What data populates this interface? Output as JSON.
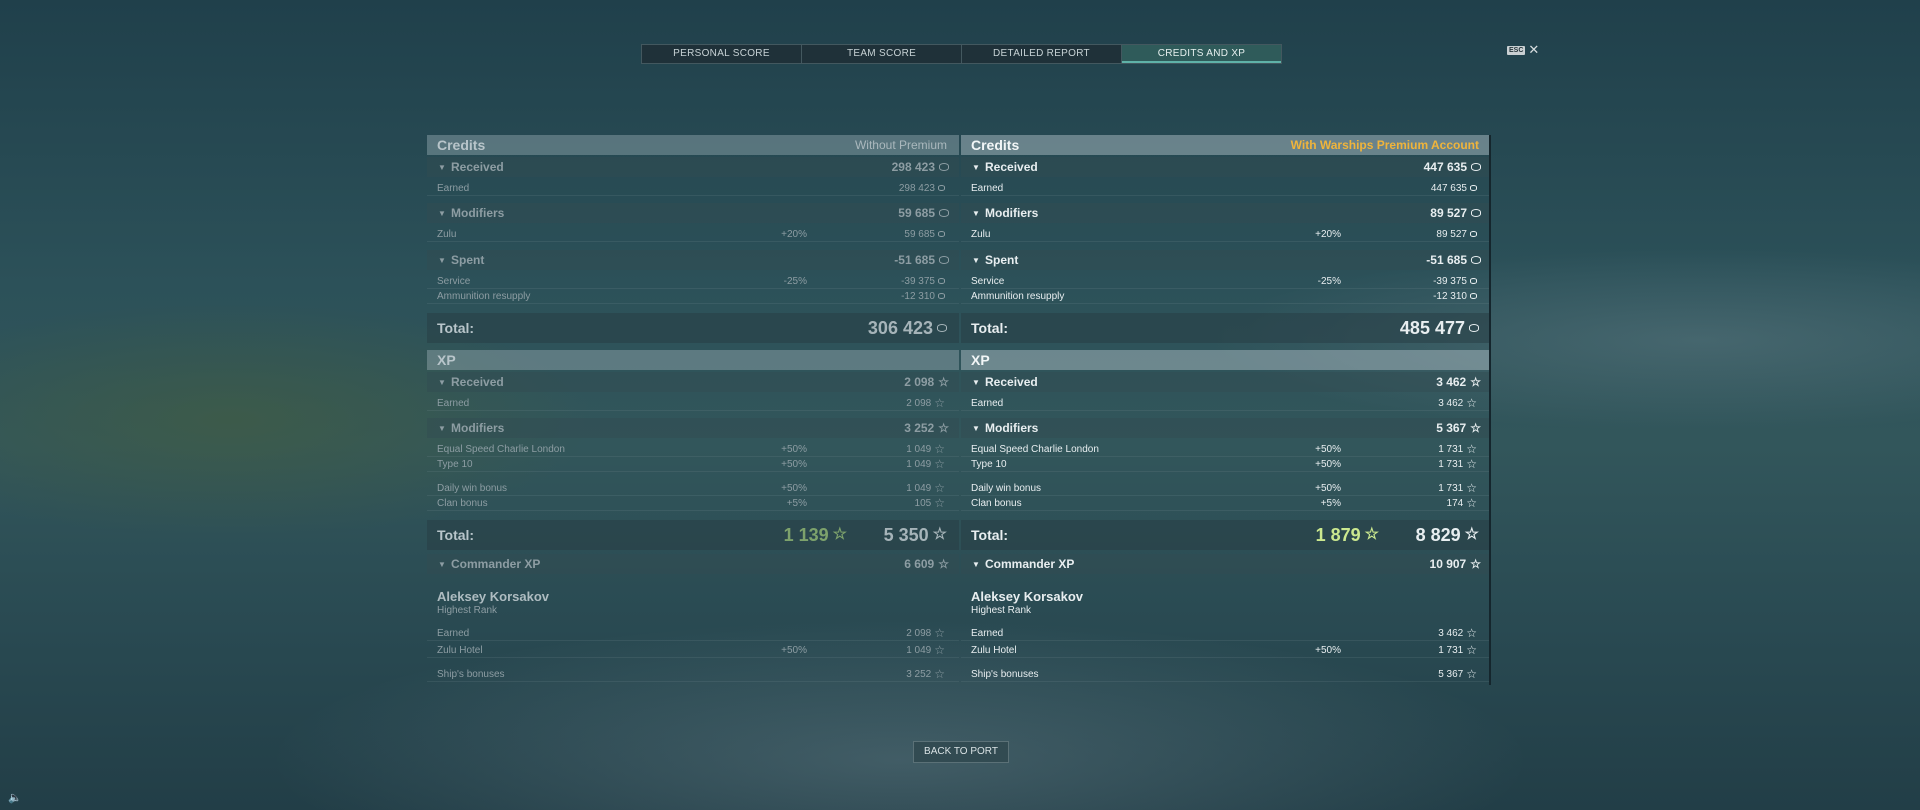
{
  "tabs": [
    "PERSONAL SCORE",
    "TEAM SCORE",
    "DETAILED REPORT",
    "CREDITS AND XP"
  ],
  "close": {
    "key": "ESC",
    "icon": "close-icon"
  },
  "left": {
    "credits_title": "Credits",
    "credits_note": "Without Premium",
    "received": {
      "label": "Received",
      "value": "298 423"
    },
    "earned": {
      "label": "Earned",
      "value": "298 423"
    },
    "modifiers": {
      "label": "Modifiers",
      "value": "59 685"
    },
    "zulu": {
      "label": "Zulu",
      "pct": "+20%",
      "value": "59 685"
    },
    "spent": {
      "label": "Spent",
      "value": "-51 685"
    },
    "service": {
      "label": "Service",
      "pct": "-25%",
      "value": "-39 375"
    },
    "ammo": {
      "label": "Ammunition resupply",
      "value": "-12 310"
    },
    "credits_total": {
      "label": "Total:",
      "value": "306 423"
    },
    "xp_title": "XP",
    "xp_received": {
      "label": "Received",
      "value": "2 098"
    },
    "xp_earned": {
      "label": "Earned",
      "value": "2 098"
    },
    "xp_modifiers": {
      "label": "Modifiers",
      "value": "3 252"
    },
    "escl": {
      "label": "Equal Speed Charlie London",
      "pct": "+50%",
      "value": "1 049"
    },
    "type10": {
      "label": "Type 10",
      "pct": "+50%",
      "value": "1 049"
    },
    "daily": {
      "label": "Daily win bonus",
      "pct": "+50%",
      "value": "1 049"
    },
    "clan": {
      "label": "Clan bonus",
      "pct": "+5%",
      "value": "105"
    },
    "xp_total": {
      "label": "Total:",
      "free": "1 139",
      "value": "5 350"
    },
    "cmd": {
      "label": "Commander XP",
      "value": "6 609"
    },
    "cmd_name": "Aleksey Korsakov",
    "cmd_rank": "Highest Rank",
    "cmd_earned": {
      "label": "Earned",
      "value": "2 098"
    },
    "zulu_hotel": {
      "label": "Zulu Hotel",
      "pct": "+50%",
      "value": "1 049"
    },
    "ship_bonus": {
      "label": "Ship's bonuses",
      "value": "3 252"
    }
  },
  "right": {
    "credits_title": "Credits",
    "credits_note": "With Warships Premium Account",
    "received": {
      "label": "Received",
      "value": "447 635"
    },
    "earned": {
      "label": "Earned",
      "value": "447 635"
    },
    "modifiers": {
      "label": "Modifiers",
      "value": "89 527"
    },
    "zulu": {
      "label": "Zulu",
      "pct": "+20%",
      "value": "89 527"
    },
    "spent": {
      "label": "Spent",
      "value": "-51 685"
    },
    "service": {
      "label": "Service",
      "pct": "-25%",
      "value": "-39 375"
    },
    "ammo": {
      "label": "Ammunition resupply",
      "value": "-12 310"
    },
    "credits_total": {
      "label": "Total:",
      "value": "485 477"
    },
    "xp_title": "XP",
    "xp_received": {
      "label": "Received",
      "value": "3 462"
    },
    "xp_earned": {
      "label": "Earned",
      "value": "3 462"
    },
    "xp_modifiers": {
      "label": "Modifiers",
      "value": "5 367"
    },
    "escl": {
      "label": "Equal Speed Charlie London",
      "pct": "+50%",
      "value": "1 731"
    },
    "type10": {
      "label": "Type 10",
      "pct": "+50%",
      "value": "1 731"
    },
    "daily": {
      "label": "Daily win bonus",
      "pct": "+50%",
      "value": "1 731"
    },
    "clan": {
      "label": "Clan bonus",
      "pct": "+5%",
      "value": "174"
    },
    "xp_total": {
      "label": "Total:",
      "free": "1 879",
      "value": "8 829"
    },
    "cmd": {
      "label": "Commander XP",
      "value": "10 907"
    },
    "cmd_name": "Aleksey Korsakov",
    "cmd_rank": "Highest Rank",
    "cmd_earned": {
      "label": "Earned",
      "value": "3 462"
    },
    "zulu_hotel": {
      "label": "Zulu Hotel",
      "pct": "+50%",
      "value": "1 731"
    },
    "ship_bonus": {
      "label": "Ship's bonuses",
      "value": "5 367"
    }
  },
  "back_button": "BACK TO PORT",
  "sound_icon": "speaker-icon"
}
